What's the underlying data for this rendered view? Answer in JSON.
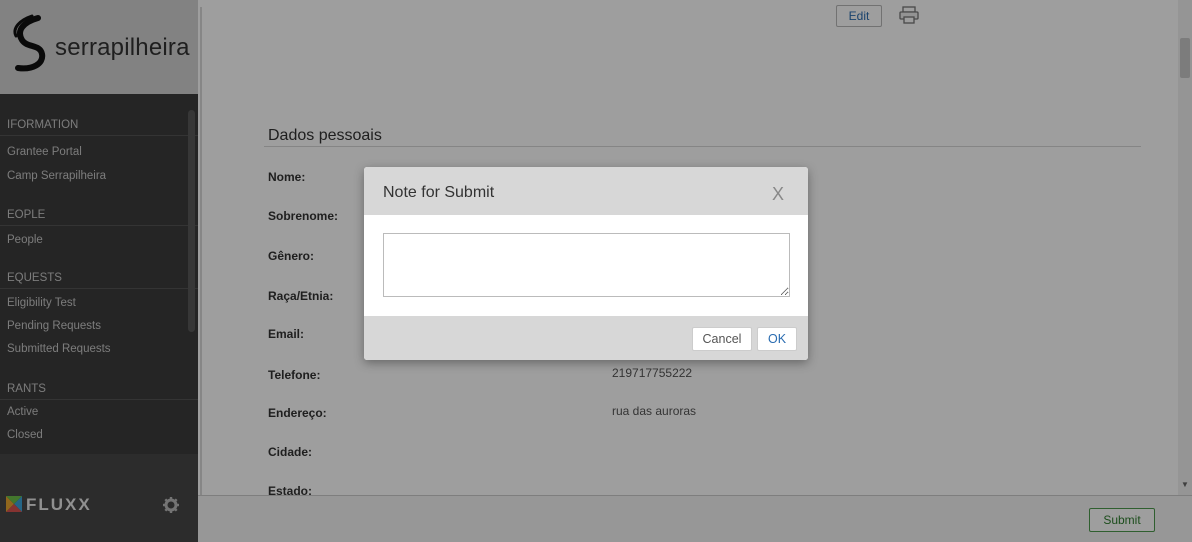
{
  "brand": {
    "name": "serrapilheira"
  },
  "nav": {
    "sections": [
      {
        "label": "IFORMATION",
        "items": [
          "Grantee Portal",
          "Camp Serrapilheira"
        ]
      },
      {
        "label": "EOPLE",
        "items": [
          "People"
        ]
      },
      {
        "label": "EQUESTS",
        "items": [
          "Eligibility Test",
          "Pending Requests",
          "Submitted Requests"
        ]
      },
      {
        "label": "RANTS",
        "items": [
          "Active",
          "Closed"
        ]
      }
    ]
  },
  "footer": {
    "product": "FLUXX"
  },
  "toolbar": {
    "edit_label": "Edit"
  },
  "section": {
    "title": "Dados pessoais",
    "fields": [
      {
        "label": "Nome:",
        "value": ""
      },
      {
        "label": "Sobrenome:",
        "value": ""
      },
      {
        "label": "Gênero:",
        "value": ""
      },
      {
        "label": "Raça/Etnia:",
        "value": ""
      },
      {
        "label": "Email:",
        "value": ""
      },
      {
        "label": "Telefone:",
        "value": "219717755222"
      },
      {
        "label": "Endereço:",
        "value": "rua das auroras"
      },
      {
        "label": "Cidade:",
        "value": ""
      },
      {
        "label": "Estado:",
        "value": ""
      }
    ]
  },
  "bottom": {
    "submit_label": "Submit"
  },
  "dialog": {
    "title": "Note for Submit",
    "close": "X",
    "note_value": "",
    "cancel_label": "Cancel",
    "ok_label": "OK"
  }
}
